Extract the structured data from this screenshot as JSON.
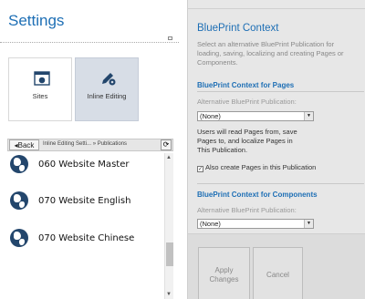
{
  "left": {
    "title": "Settings",
    "tiles": [
      {
        "label": "Sites",
        "icon": "sites-window-icon"
      },
      {
        "label": "Inline Editing",
        "icon": "pencil-gear-icon"
      }
    ],
    "nav": {
      "back_label": "Back",
      "breadcrumb": "Inline Editing Setti...  »  Publications",
      "refresh_icon": "refresh-icon"
    },
    "list": [
      {
        "label": "060 Website Master"
      },
      {
        "label": "070 Website English"
      },
      {
        "label": "070 Website Chinese"
      }
    ]
  },
  "right": {
    "title": "BluePrint Context",
    "description": "Select an alternative BluePrint Publication for loading, saving, localizing and creating Pages or Components.",
    "pages_section": {
      "heading": "BluePrint Context for Pages",
      "field_label": "Alternative BluePrint Publication:",
      "selected": "(None)",
      "info": "Users will read Pages from, save Pages to, and localize Pages in This Publication.",
      "checkbox_label": "Also create Pages in this Publication",
      "checkbox_checked": true
    },
    "components_section": {
      "heading": "BluePrint Context for Components",
      "field_label": "Alternative BluePrint Publication:",
      "selected": "(None)"
    },
    "buttons": {
      "apply_line1": "Apply",
      "apply_line2": "Changes",
      "cancel": "Cancel"
    }
  },
  "colors": {
    "accent_blue": "#1e6fb5",
    "globe": "#23466c",
    "selected_tile": "#d7dde6",
    "panel_bg": "#e7e7e7"
  }
}
